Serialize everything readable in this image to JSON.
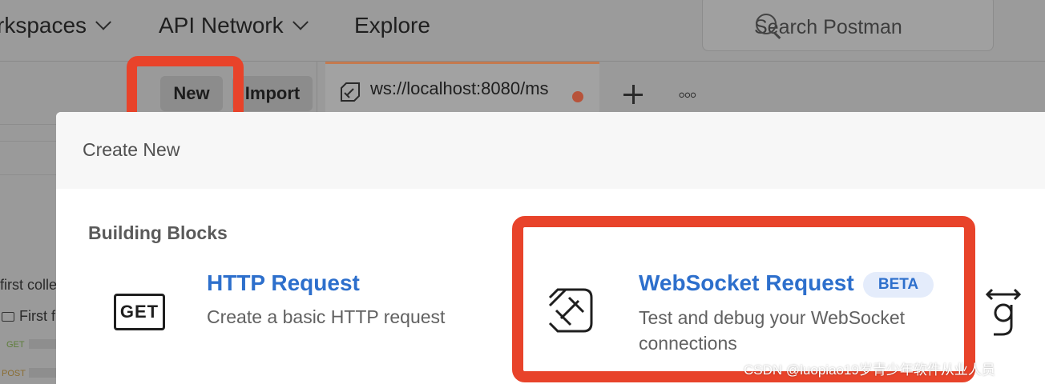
{
  "nav": {
    "workspaces": "rkspaces",
    "api_network": "API Network",
    "explore": "Explore"
  },
  "search": {
    "placeholder": "Search Postman"
  },
  "sidebar": {
    "new_label": "New",
    "import_label": "Import",
    "collection_text": "first colle",
    "folder_text": "First f",
    "get_tag": "GET",
    "post_tag": "POST"
  },
  "tab": {
    "label": "ws://localhost:8080/ms"
  },
  "modal": {
    "title": "Create New",
    "section": "Building Blocks",
    "http": {
      "icon_text": "GET",
      "title": "HTTP Request",
      "desc": "Create a basic HTTP request"
    },
    "websocket": {
      "title": "WebSocket Request",
      "badge": "BETA",
      "desc_line1": "Test and debug your WebSocket",
      "desc_line2": "connections"
    }
  },
  "watermark": "CSDN @luopiao19岁青少年软件从业人员",
  "icons": {
    "search": "search-icon",
    "websocket": "websocket-icon",
    "plus": "plus-icon",
    "more": "more-icon",
    "graphql": "graphql-icon",
    "folder": "folder-icon"
  },
  "colors": {
    "highlight": "#e8432a",
    "link_blue": "#2d6fcc",
    "beta_bg": "#e4ecfb",
    "tab_accent": "#c47a4f"
  }
}
